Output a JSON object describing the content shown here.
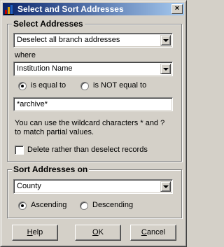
{
  "window": {
    "title": "Select and Sort Addresses",
    "close_glyph": "×"
  },
  "select_group": {
    "label": "Select Addresses",
    "action_combo": "Deselect all branch addresses",
    "where_label": "where",
    "field_combo": "Institution Name",
    "radio_equal": "is equal to",
    "radio_not_equal": "is NOT equal to",
    "radio_selected": "equal",
    "value_input": "*archive*",
    "hint_line1": "You can use the wildcard characters * and ?",
    "hint_line2": "to match partial values.",
    "delete_checkbox_label": "Delete rather than deselect records",
    "delete_checked": false
  },
  "sort_group": {
    "label": "Sort Addresses on",
    "sort_combo": "County",
    "radio_ascending": "Ascending",
    "radio_descending": "Descending",
    "order_selected": "ascending"
  },
  "buttons": {
    "help": {
      "accel": "H",
      "rest": "elp"
    },
    "ok": {
      "accel": "O",
      "rest": "K"
    },
    "cancel": {
      "accel": "C",
      "rest": "ancel"
    }
  },
  "colors": {
    "title_gradient_start": "#0a246a",
    "title_gradient_end": "#a6caf0",
    "face": "#d4d0c8"
  }
}
